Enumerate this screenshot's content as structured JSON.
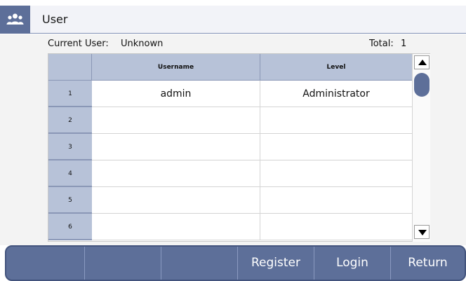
{
  "header": {
    "title": "User",
    "icon": "users-group-icon"
  },
  "status": {
    "current_user_label": "Current User:",
    "current_user_value": "Unknown",
    "total_label": "Total:",
    "total_value": "1"
  },
  "table": {
    "columns": [
      "Username",
      "Level"
    ],
    "rows": [
      {
        "num": "1",
        "username": "admin",
        "level": "Administrator"
      },
      {
        "num": "2",
        "username": "",
        "level": ""
      },
      {
        "num": "3",
        "username": "",
        "level": ""
      },
      {
        "num": "4",
        "username": "",
        "level": ""
      },
      {
        "num": "5",
        "username": "",
        "level": ""
      },
      {
        "num": "6",
        "username": "",
        "level": ""
      }
    ]
  },
  "toolbar": {
    "buttons": [
      "",
      "",
      "",
      "Register",
      "Login",
      "Return"
    ]
  },
  "colors": {
    "accent": "#5d6f99",
    "header_fill": "#b7c2d8"
  }
}
